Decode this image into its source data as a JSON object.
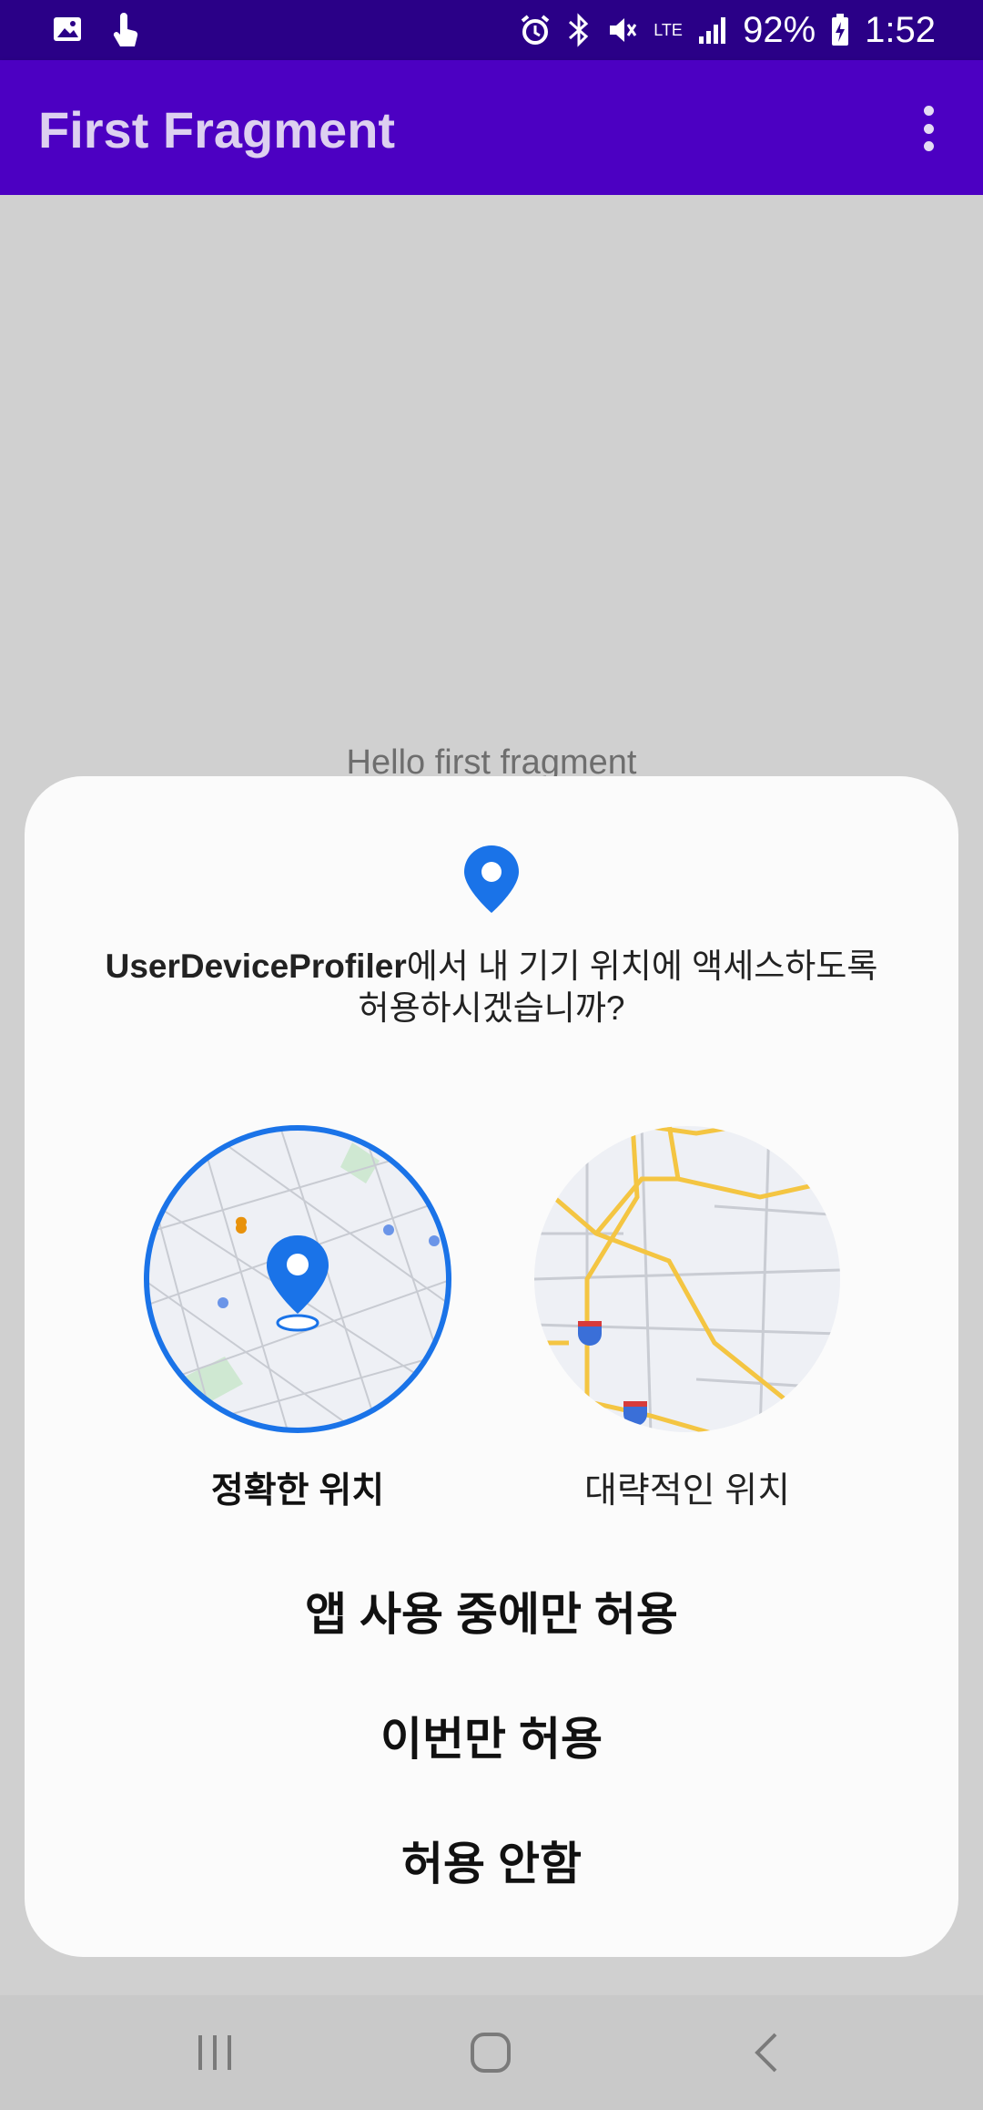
{
  "status_bar": {
    "battery": "92%",
    "time": "1:52",
    "icons": [
      "gallery-icon",
      "touch-icon",
      "alarm-icon",
      "bluetooth-icon",
      "mute-icon",
      "lte-icon",
      "signal-icon",
      "battery-charging-icon"
    ],
    "lte_label": "LTE"
  },
  "app_bar": {
    "title": "First Fragment"
  },
  "content": {
    "hello": "Hello first fragment"
  },
  "dialog": {
    "app_name": "UserDeviceProfiler",
    "prompt_line1": "에서 내 기기 위치에 액세스하도록",
    "prompt_line2": "허용하시겠습니까?",
    "precise_label": "정확한 위치",
    "approximate_label": "대략적인 위치",
    "selected_option": "정확한 위치",
    "accent_color": "#1a73e8",
    "actions": {
      "while_using": "앱 사용 중에만 허용",
      "only_this_time": "이번만 허용",
      "deny": "허용 안함"
    }
  },
  "nav_bar": {
    "buttons": [
      "recents-icon",
      "home-icon",
      "back-icon"
    ]
  }
}
